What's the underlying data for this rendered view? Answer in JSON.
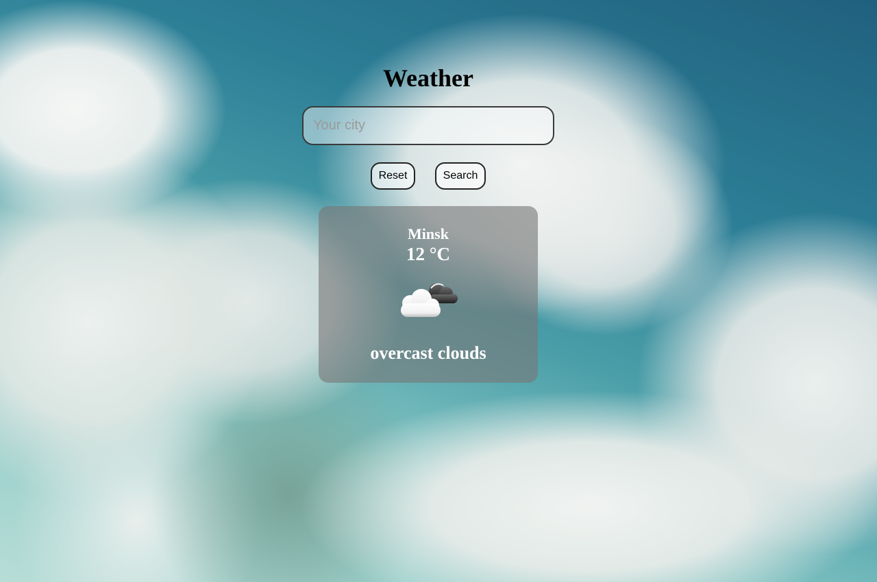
{
  "app": {
    "title": "Weather"
  },
  "search": {
    "placeholder": "Your city",
    "value": ""
  },
  "buttons": {
    "reset_label": "Reset",
    "search_label": "Search"
  },
  "weather": {
    "city": "Minsk",
    "temperature": "12 °C",
    "description": "overcast clouds",
    "icon": "overcast-clouds-icon"
  },
  "colors": {
    "card_background": "#787878",
    "text": "#ffffff",
    "sky": "#2c7e96"
  }
}
